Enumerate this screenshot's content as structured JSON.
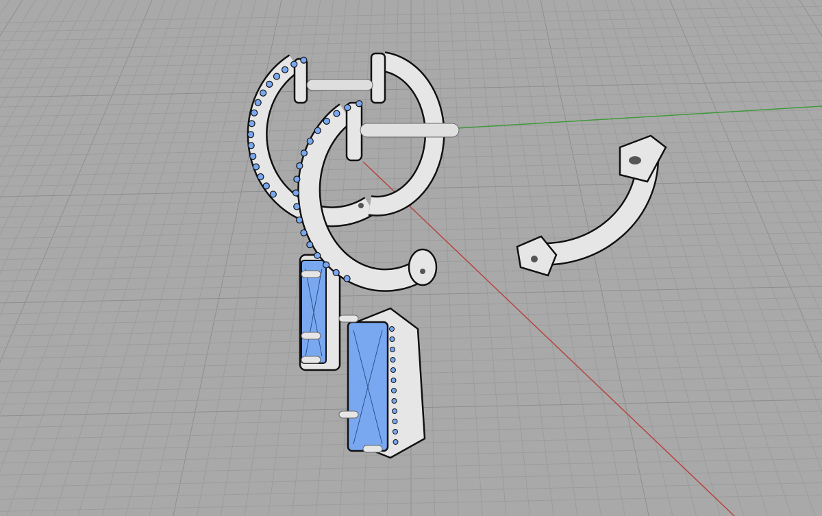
{
  "viewport": {
    "view": "perspective",
    "display_mode": "shaded",
    "colors": {
      "background": "#a9a9a9",
      "grid_minor": "#9c9c9c",
      "grid_major": "#8e8e8e",
      "x_axis": "#b5443f",
      "y_axis": "#3f9a3a",
      "metal": "#e6e6e6",
      "gem": "#7aa8f0",
      "outline": "#111111"
    }
  },
  "objects": [
    {
      "name": "hoop-earring-back"
    },
    {
      "name": "hoop-earring-front"
    },
    {
      "name": "hoop-clasp-open"
    },
    {
      "name": "emerald-drop-back"
    },
    {
      "name": "emerald-drop-front"
    }
  ]
}
